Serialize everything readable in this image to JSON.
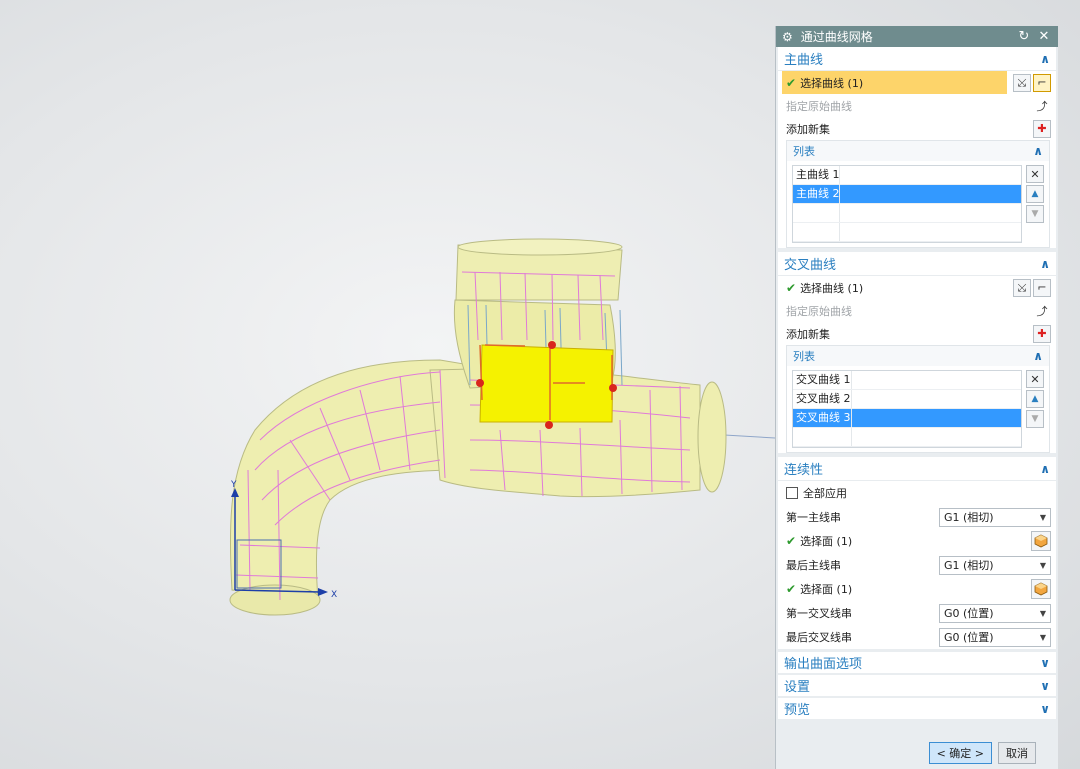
{
  "viewport": {
    "axis_y": "Y",
    "axis_x": "X"
  },
  "dialog": {
    "title": "通过曲线网格",
    "icons": {
      "gear": "gear-icon",
      "reset": "reset-icon",
      "close": "close-icon"
    }
  },
  "primary_curves": {
    "header": "主曲线",
    "select_label": "选择曲线 (1)",
    "specify_origin_label": "指定原始曲线",
    "add_set_label": "添加新集",
    "list_header": "列表",
    "items": [
      "主曲线 1",
      "主曲线 2"
    ],
    "selected_index": 1
  },
  "cross_curves": {
    "header": "交叉曲线",
    "select_label": "选择曲线 (1)",
    "specify_origin_label": "指定原始曲线",
    "add_set_label": "添加新集",
    "list_header": "列表",
    "items": [
      "交叉曲线 1",
      "交叉曲线 2",
      "交叉曲线 3"
    ],
    "selected_index": 2
  },
  "continuity": {
    "header": "连续性",
    "apply_all_label": "全部应用",
    "apply_all_checked": false,
    "first_primary_label": "第一主线串",
    "first_primary_value": "G1 (相切)",
    "face1_label": "选择面 (1)",
    "last_primary_label": "最后主线串",
    "last_primary_value": "G1 (相切)",
    "face2_label": "选择面 (1)",
    "first_cross_label": "第一交叉线串",
    "first_cross_value": "G0 (位置)",
    "last_cross_label": "最后交叉线串",
    "last_cross_value": "G0 (位置)"
  },
  "collapsed_sections": {
    "output": "输出曲面选项",
    "settings": "设置",
    "preview": "预览"
  },
  "footer": {
    "ok_label": "< 确定 >",
    "cancel_label": "取消"
  },
  "colors": {
    "title_bar": "#6f8c8e",
    "section_header_text": "#2a7fc0",
    "selection_row": "#fdd46a",
    "list_highlight": "#3399ff",
    "model_body": "#eeeeb0",
    "model_edges": "#e07ad8",
    "yellow_patch": "#f5f200"
  }
}
